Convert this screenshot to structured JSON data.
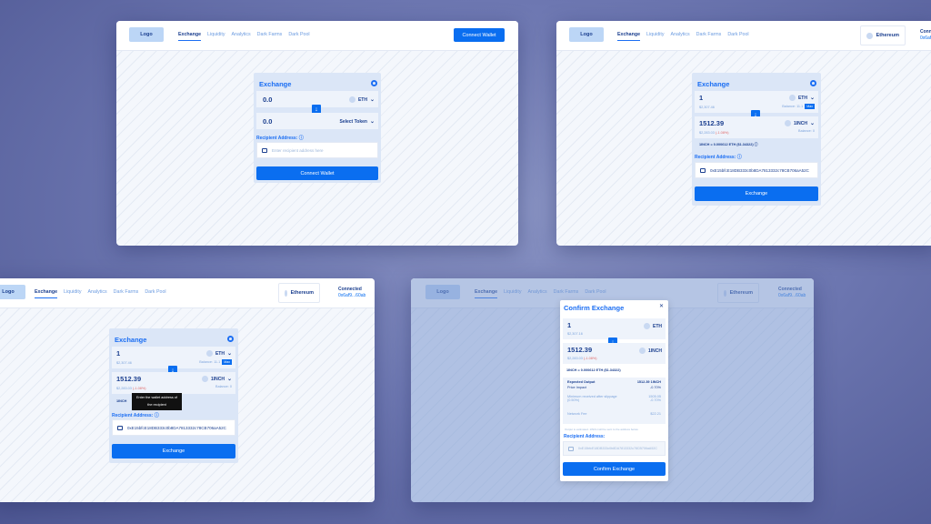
{
  "nav": {
    "logo": "Logo",
    "links": [
      "Exchange",
      "Liquidity",
      "Analytics",
      "Dark Farms",
      "Dark Pool"
    ],
    "connect_wallet": "Connect Wallet",
    "network": "Ethereum",
    "connected_label": "Connected",
    "connected_addr": "0x6af9...60ab",
    "connected_addr_cut": "0x6af"
  },
  "s1": {
    "title": "Exchange",
    "from_amount": "0.0",
    "from_token": "ETH",
    "to_amount": "0.0",
    "to_token": "Select Token",
    "recipient_label": "Recipient Address:",
    "recipient_placeholder": "Enter recipient address here",
    "button": "Connect Wallet"
  },
  "s2": {
    "title": "Exchange",
    "from_amount": "1",
    "from_usd": "$2,307.46",
    "from_token": "ETH",
    "balance": "Balance: 11.1",
    "max": "Max",
    "to_amount": "1512.39",
    "to_usd": "$2,283.03",
    "to_change": "(-1.08%)",
    "to_token": "1INCH",
    "to_balance": "Balance: 0",
    "rate": "1INCH = 0.000612 ETH ($1.34322)",
    "recipient_label": "Recipient Address:",
    "recipient_value": "0xE15bfcE18DB333c0b8DA7813332c78CB706aA52C",
    "button": "Exchange"
  },
  "s3": {
    "title": "Exchange",
    "from_amount": "1",
    "from_usd": "$2,307.46",
    "from_token": "ETH",
    "balance": "Balance: 11.1",
    "max": "Max",
    "to_amount": "1512.39",
    "to_usd": "$2,283.03",
    "to_change": "(-1.08%)",
    "to_token": "1INCH",
    "to_balance": "Balance: 0",
    "rate_cut": "1INCH",
    "tooltip_line1": "Enter the wallet address of",
    "tooltip_line2": "the recipient",
    "recipient_label": "Recipient Address:",
    "recipient_value": "0xE15bfcE18DB333c0b8DA7813332c78CB706aA52C",
    "button": "Exchange"
  },
  "s4": {
    "title": "Confirm Exchange",
    "close": "✕",
    "from_amount": "1",
    "from_usd": "$2,307.16",
    "from_token": "ETH",
    "to_amount": "1512.39",
    "to_usd": "$2,283.03",
    "to_change": "(-1.08%)",
    "to_token": "1INCH",
    "rate": "1INCH = 0.000612 ETH ($1.34322)",
    "expected_output_label": "Expected Output",
    "expected_output_value": "1512.39 1INCH",
    "price_impact_label": "Price Impact",
    "price_impact_value": "-0.70%",
    "min_received_label": "Minimum received after slippage (0.50%)",
    "min_received_value": "1505.05",
    "min_received_pct": "-0.70%",
    "network_fee_label": "Network Fee",
    "network_fee_value": "$22.21",
    "note": "Output is estimated. 1INCH will be sent to the address below.",
    "recipient_label": "Recipient Address:",
    "recipient_value": "0xE15bfcE18DB333c0b8DA7813332c78CB706aA52C",
    "button": "Confirm Exchange"
  }
}
